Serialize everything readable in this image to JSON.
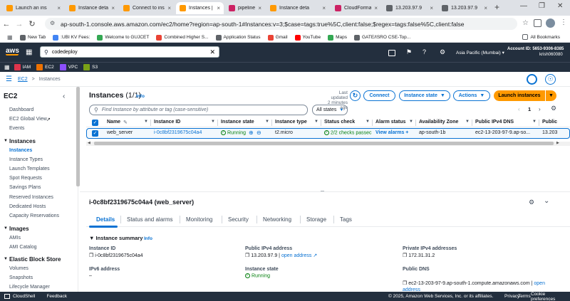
{
  "browser": {
    "tabs": [
      {
        "label": "Launch an ins",
        "color": "#ff9900"
      },
      {
        "label": "Instance deta",
        "color": "#ff9900"
      },
      {
        "label": "Connect to ins",
        "color": "#ff9900"
      },
      {
        "label": "Instances | EC",
        "color": "#ff9900"
      },
      {
        "label": "pipelineqq | E",
        "color": "#cc2264"
      },
      {
        "label": "Instance deta",
        "color": "#ff9900"
      },
      {
        "label": "CloudFormat",
        "color": "#cc2264"
      },
      {
        "label": "13.203.97.9",
        "color": "#5f6368"
      },
      {
        "label": "13.203.97.9",
        "color": "#5f6368"
      }
    ],
    "new_tab": "+",
    "url": "ap-south-1.console.aws.amazon.com/ec2/home?region=ap-south-1#Instances:v=3;$case=tags:true%5C,client:false;$regex=tags:false%5C,client:false",
    "bookmarks": [
      {
        "label": "New Tab",
        "color": "#5f6368"
      },
      {
        "label": ":UBI KV Fees:",
        "color": "#4285f4"
      },
      {
        "label": "Welcome to GUJCET",
        "color": "#34a853"
      },
      {
        "label": "Combined Higher S...",
        "color": "#ea4335"
      },
      {
        "label": "Application Status",
        "color": "#5f6368"
      },
      {
        "label": "Gmail",
        "color": "#ea4335"
      },
      {
        "label": "YouTube",
        "color": "#ff0000"
      },
      {
        "label": "Maps",
        "color": "#34a853"
      },
      {
        "label": "GATE/ISRO CSE-Top...",
        "color": "#5f6368"
      }
    ],
    "all_bookmarks": "All Bookmarks"
  },
  "aws": {
    "logo": "aws",
    "search_value": "codedeploy",
    "region": "Asia Pacific (Mumbai)",
    "account_id": "Account ID: 5653-9306-8385",
    "user": "krish060080",
    "favorites": [
      {
        "label": "IAM",
        "color": "#dd344c"
      },
      {
        "label": "EC2",
        "color": "#ed7100"
      },
      {
        "label": "VPC",
        "color": "#8c4fff"
      },
      {
        "label": "S3",
        "color": "#7aa116"
      }
    ]
  },
  "breadcrumb": {
    "service": "EC2",
    "separator": ">",
    "page": "Instances"
  },
  "sidebar": {
    "title": "EC2",
    "items_top": [
      "Dashboard",
      "EC2 Global View",
      "Events"
    ],
    "instances_header": "Instances",
    "instances_items": [
      "Instances",
      "Instance Types",
      "Launch Templates",
      "Spot Requests",
      "Savings Plans",
      "Reserved Instances",
      "Dedicated Hosts",
      "Capacity Reservations"
    ],
    "images_header": "Images",
    "images_items": [
      "AMIs",
      "AMI Catalog"
    ],
    "ebs_header": "Elastic Block Store",
    "ebs_items": [
      "Volumes",
      "Snapshots",
      "Lifecycle Manager"
    ]
  },
  "main": {
    "title": "Instances",
    "count": "(1/1)",
    "info": "Info",
    "last_updated_label": "Last updated",
    "last_updated_value": "2 minutes ago",
    "connect": "Connect",
    "instance_state": "Instance state",
    "actions": "Actions",
    "launch": "Launch instances",
    "search_placeholder": "Find Instance by attribute or tag (case-sensitive)",
    "filter": "All states",
    "page": "1",
    "columns": [
      "Name",
      "Instance ID",
      "Instance state",
      "Instance type",
      "Status check",
      "Alarm status",
      "Availability Zone",
      "Public IPv4 DNS",
      "Public"
    ],
    "row": {
      "name": "web_server",
      "id": "i-0c8bf2319675c04a4",
      "state": "Running",
      "type": "t2.micro",
      "status": "2/2 checks passec",
      "alarm": "View alarms",
      "az": "ap-south-1b",
      "dns": "ec2-13-203-97-9.ap-so...",
      "ip": "13.203"
    }
  },
  "detail": {
    "title": "i-0c8bf2319675c04a4 (web_server)",
    "tabs": [
      "Details",
      "Status and alarms",
      "Monitoring",
      "Security",
      "Networking",
      "Storage",
      "Tags"
    ],
    "summary": "Instance summary",
    "info": "Info",
    "instance_id_label": "Instance ID",
    "instance_id": "i-0c8bf2319675c04a4",
    "public_ipv4_label": "Public IPv4 address",
    "public_ipv4": "13.203.97.9",
    "open_address": "open address",
    "private_ipv4_label": "Private IPv4 addresses",
    "private_ipv4": "172.31.31.2",
    "ipv6_label": "IPv6 address",
    "ipv6": "–",
    "state_label": "Instance state",
    "state": "Running",
    "public_dns_label": "Public DNS",
    "public_dns": "ec2-13-203-97-9.ap-south-1.compute.amazonaws.com",
    "open_address2": "open address"
  },
  "footer": {
    "cloudshell": "CloudShell",
    "feedback": "Feedback",
    "copyright": "© 2025, Amazon Web Services, Inc. or its affiliates.",
    "privacy": "Privacy",
    "terms": "Terms",
    "cookie": "Cookie preferences"
  }
}
